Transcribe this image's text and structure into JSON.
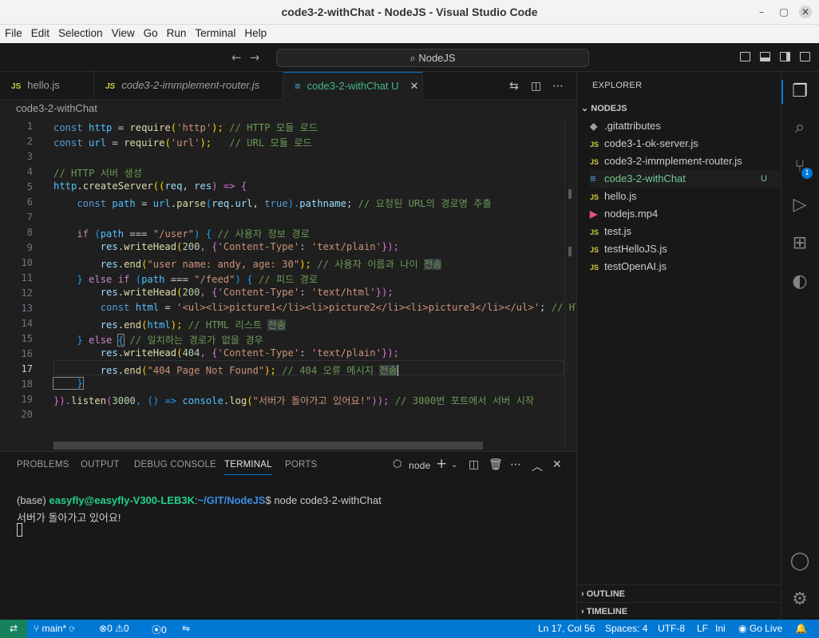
{
  "window": {
    "title": "code3-2-withChat - NodeJS - Visual Studio Code"
  },
  "menu": [
    "File",
    "Edit",
    "Selection",
    "View",
    "Go",
    "Run",
    "Terminal",
    "Help"
  ],
  "command_center": {
    "label": "NodeJS"
  },
  "tabs": [
    {
      "label": "hello.js",
      "icon": "JS"
    },
    {
      "label": "code3-2-immplement-router.js",
      "icon": "JS"
    },
    {
      "label": "code3-2-withChat",
      "badge": "U"
    }
  ],
  "breadcrumb": "code3-2-withChat",
  "code_lines": [
    {
      "n": "1"
    },
    {
      "n": "2"
    },
    {
      "n": "3"
    },
    {
      "n": "4"
    },
    {
      "n": "5"
    },
    {
      "n": "6"
    },
    {
      "n": "7"
    },
    {
      "n": "8"
    },
    {
      "n": "9"
    },
    {
      "n": "10"
    },
    {
      "n": "11"
    },
    {
      "n": "12"
    },
    {
      "n": "13"
    },
    {
      "n": "14"
    },
    {
      "n": "15"
    },
    {
      "n": "16"
    },
    {
      "n": "17"
    },
    {
      "n": "18"
    },
    {
      "n": "19"
    },
    {
      "n": "20"
    }
  ],
  "code": {
    "l1": {
      "a": "const ",
      "b": "http",
      "c": " = ",
      "d": "require",
      "e": "(",
      "f": "'http'",
      "g": "); ",
      "h": "// HTTP 모듈 로드"
    },
    "l2": {
      "a": "const ",
      "b": "url",
      "c": " = ",
      "d": "require",
      "e": "(",
      "f": "'url'",
      "g": ");   ",
      "h": "// URL 모듈 로드"
    },
    "l4": {
      "h": "// HTTP 서버 생성"
    },
    "l5": {
      "a": "http",
      "b": ".",
      "c": "createServer",
      "d": "((",
      "e": "req",
      "f": ", ",
      "g": "res",
      "h": ") => {"
    },
    "l6": {
      "a": "    const ",
      "b": "path",
      "c": " = ",
      "d": "url",
      "e": ".",
      "f": "parse",
      "g": "(",
      "h": "req",
      "i": ".",
      "j": "url",
      "k": ", ",
      "l": "true",
      "m": ").",
      "n": "pathname",
      "o": "; ",
      "p": "// 요청된 URL의 경로명 추출"
    },
    "l8": {
      "a": "    if ",
      "b": "(",
      "c": "path",
      "d": " === ",
      "e": "\"/user\"",
      "f": ") { ",
      "g": "// 사용자 정보 경로"
    },
    "l9": {
      "a": "        res",
      "b": ".",
      "c": "writeHead",
      "d": "(",
      "e": "200",
      "f": ", {",
      "g": "'Content-Type'",
      "h": ": ",
      "i": "'text/plain'",
      "j": "});"
    },
    "l10": {
      "a": "        res",
      "b": ".",
      "c": "end",
      "d": "(",
      "e": "\"user name: andy, age: 30\"",
      "f": "); ",
      "g": "// 사용자 이름과 나이 ",
      "h": "전송"
    },
    "l11": {
      "a": "    } ",
      "b": "else if ",
      "c": "(",
      "d": "path",
      "e": " === ",
      "f": "\"/feed\"",
      "g": ") { ",
      "h": "// 피드 경로"
    },
    "l12": {
      "a": "        res",
      "b": ".",
      "c": "writeHead",
      "d": "(",
      "e": "200",
      "f": ", {",
      "g": "'Content-Type'",
      "h": ": ",
      "i": "'text/html'",
      "j": "});"
    },
    "l13": {
      "a": "        const ",
      "b": "html",
      "c": " = ",
      "d": "'<ul><li>picture1</li><li>picture2</li><li>picture3</li></ul>'",
      "e": "; ",
      "f": "// HTML i"
    },
    "l14": {
      "a": "        res",
      "b": ".",
      "c": "end",
      "d": "(",
      "e": "html",
      "f": "); ",
      "g": "// HTML 리스트 ",
      "h": "전송"
    },
    "l15": {
      "a": "    } ",
      "b": "else ",
      "c": "{",
      "d": " ",
      "e": "// 일치하는 경로가 없을 경우"
    },
    "l16": {
      "a": "        res",
      "b": ".",
      "c": "writeHead",
      "d": "(",
      "e": "404",
      "f": ", {",
      "g": "'Content-Type'",
      "h": ": ",
      "i": "'text/plain'",
      "j": "});"
    },
    "l17": {
      "a": "        res",
      "b": ".",
      "c": "end",
      "d": "(",
      "e": "\"404 Page Not Found\"",
      "f": "); ",
      "g": "// 404 오류 메시지 ",
      "h": "전송"
    },
    "l18": {
      "a": "    }"
    },
    "l19": {
      "a": "}",
      "b": ").",
      "c": "listen",
      "d": "(",
      "e": "3000",
      "f": ", () => ",
      "g": "console",
      "h": ".",
      "i": "log",
      "j": "(",
      "k": "\"서버가 돌아가고 있어요!\"",
      "l": ")); ",
      "m": "// 3000번 포트에서 서버 시작"
    }
  },
  "panel": {
    "tabs": [
      "PROBLEMS",
      "OUTPUT",
      "DEBUG CONSOLE",
      "TERMINAL",
      "PORTS"
    ],
    "active_tab": "TERMINAL",
    "terminal_name": "node",
    "prompt_env": "(base) ",
    "prompt_user": "easyfly@easyfly-V300-LEB3K",
    "prompt_sep": ":",
    "prompt_path": "~/GIT/NodeJS",
    "prompt_cmd": "$ node code3-2-withChat",
    "output": "서버가 돌아가고 있어요!"
  },
  "explorer": {
    "header": "EXPLORER",
    "folder": "NODEJS",
    "files": [
      {
        "name": ".gitattributes",
        "icon": "git"
      },
      {
        "name": "code3-1-ok-server.js",
        "icon": "JS"
      },
      {
        "name": "code3-2-immplement-router.js",
        "icon": "JS"
      },
      {
        "name": "code3-2-withChat",
        "icon": "lines",
        "status": "U"
      },
      {
        "name": "hello.js",
        "icon": "JS"
      },
      {
        "name": "nodejs.mp4",
        "icon": "media"
      },
      {
        "name": "test.js",
        "icon": "JS"
      },
      {
        "name": "testHelloJS.js",
        "icon": "JS"
      },
      {
        "name": "testOpenAI.js",
        "icon": "JS"
      }
    ],
    "outline": "OUTLINE",
    "timeline": "TIMELINE"
  },
  "activity": {
    "scm_badge": "1"
  },
  "status": {
    "branch": "main*",
    "errors": "0",
    "warnings": "0",
    "ports": "0",
    "position": "Ln 17, Col 56",
    "spaces": "Spaces: 4",
    "encoding": "UTF-8",
    "eol": "LF",
    "language": "Ini",
    "golive": "Go Live"
  },
  "colors": {
    "accent": "#0078d4",
    "statusbar": "#0078d4",
    "remote": "#16825d",
    "untracked": "#73c991"
  }
}
